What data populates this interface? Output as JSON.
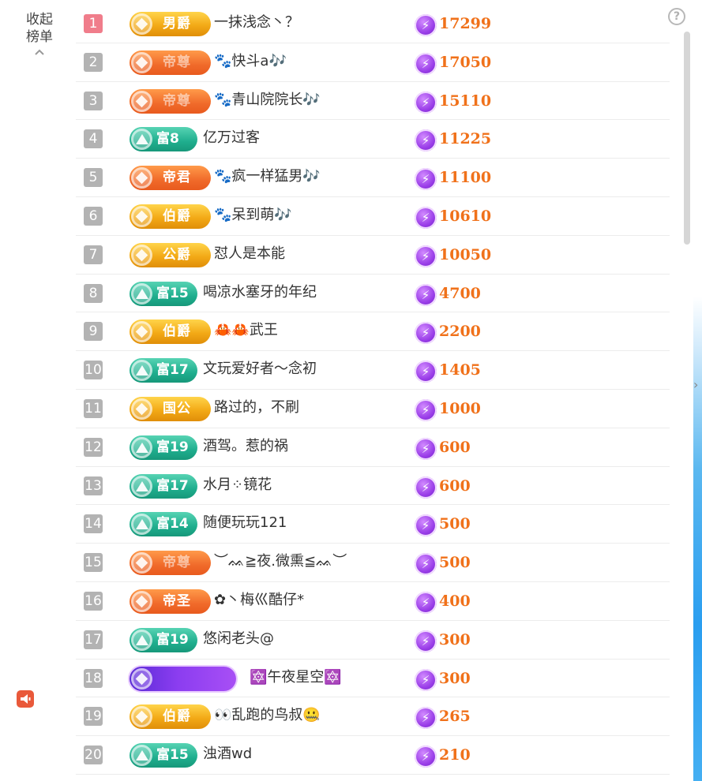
{
  "sidebar": {
    "collapse_line1": "收起",
    "collapse_line2": "榜单"
  },
  "help_symbol": "?",
  "colors": {
    "score": "#f0711a",
    "top_rank": "#f07d8b",
    "rank": "#b3b3b3"
  },
  "rows": [
    {
      "rank": "1",
      "badge": "男爵",
      "badge_style": "gold",
      "name": "一抹浅念丶？",
      "score": "17299"
    },
    {
      "rank": "2",
      "badge": "帝尊",
      "badge_style": "orange-faded",
      "name": "🐾快斗a🎶",
      "score": "17050"
    },
    {
      "rank": "3",
      "badge": "帝尊",
      "badge_style": "orange-faded",
      "name": "🐾青山院院长🎶",
      "score": "15110"
    },
    {
      "rank": "4",
      "badge": "富8",
      "badge_style": "teal",
      "name": "亿万过客",
      "score": "11225"
    },
    {
      "rank": "5",
      "badge": "帝君",
      "badge_style": "orange",
      "name": "🐾疯一样猛男🎶",
      "score": "11100"
    },
    {
      "rank": "6",
      "badge": "伯爵",
      "badge_style": "gold",
      "name": "🐾呆到萌🎶",
      "score": "10610"
    },
    {
      "rank": "7",
      "badge": "公爵",
      "badge_style": "gold",
      "name": "怼人是本能",
      "score": "10050"
    },
    {
      "rank": "8",
      "badge": "富15",
      "badge_style": "teal",
      "name": "喝凉水塞牙的年纪",
      "score": "4700"
    },
    {
      "rank": "9",
      "badge": "伯爵",
      "badge_style": "gold",
      "name": "🦀🦀武王",
      "score": "2200"
    },
    {
      "rank": "10",
      "badge": "富17",
      "badge_style": "teal",
      "name": "文玩爱好者～念初",
      "score": "1405"
    },
    {
      "rank": "11",
      "badge": "国公",
      "badge_style": "gold",
      "name": "路过的，不刷",
      "score": "1000"
    },
    {
      "rank": "12",
      "badge": "富19",
      "badge_style": "teal",
      "name": "酒驾。惹的祸",
      "score": "600"
    },
    {
      "rank": "13",
      "badge": "富17",
      "badge_style": "teal",
      "name": "水月⁘镜花",
      "score": "600"
    },
    {
      "rank": "14",
      "badge": "富14",
      "badge_style": "teal",
      "name": "随便玩玩121",
      "score": "500"
    },
    {
      "rank": "15",
      "badge": "帝尊",
      "badge_style": "orange-faded",
      "name": "︶ᨐ≧夜.微熏≦ᨐ︶",
      "score": "500"
    },
    {
      "rank": "16",
      "badge": "帝圣",
      "badge_style": "orange",
      "name": "✿丶梅巛酷仔*",
      "score": "400"
    },
    {
      "rank": "17",
      "badge": "富19",
      "badge_style": "teal",
      "name": "悠闲老头@",
      "score": "300"
    },
    {
      "rank": "18",
      "badge": "",
      "badge_style": "purple",
      "name": "🔯午夜星空🔯",
      "score": "300"
    },
    {
      "rank": "19",
      "badge": "伯爵",
      "badge_style": "gold",
      "name": "👀乱跑的鸟叔🤐",
      "score": "265"
    },
    {
      "rank": "20",
      "badge": "富15",
      "badge_style": "teal",
      "name": "浊酒wd",
      "score": "210"
    }
  ]
}
